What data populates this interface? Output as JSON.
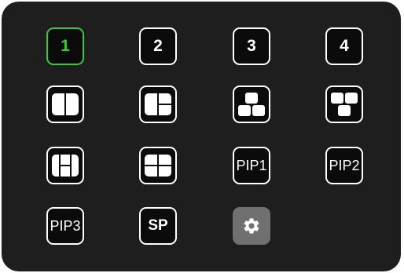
{
  "accent_color": "#3ec63e",
  "buttons": {
    "view1": {
      "label": "1",
      "active": true
    },
    "view2": {
      "label": "2"
    },
    "view3": {
      "label": "3"
    },
    "view4": {
      "label": "4"
    },
    "pip1": {
      "label": "PIP1"
    },
    "pip2": {
      "label": "PIP2"
    },
    "pip3": {
      "label": "PIP3"
    },
    "sp": {
      "label": "SP"
    }
  },
  "icons": [
    "split-two-vertical-icon",
    "split-one-plus-two-icon",
    "one-top-two-bottom-icon",
    "two-top-one-bottom-icon",
    "split-three-h-icon",
    "quad-split-icon",
    "gear-icon"
  ]
}
